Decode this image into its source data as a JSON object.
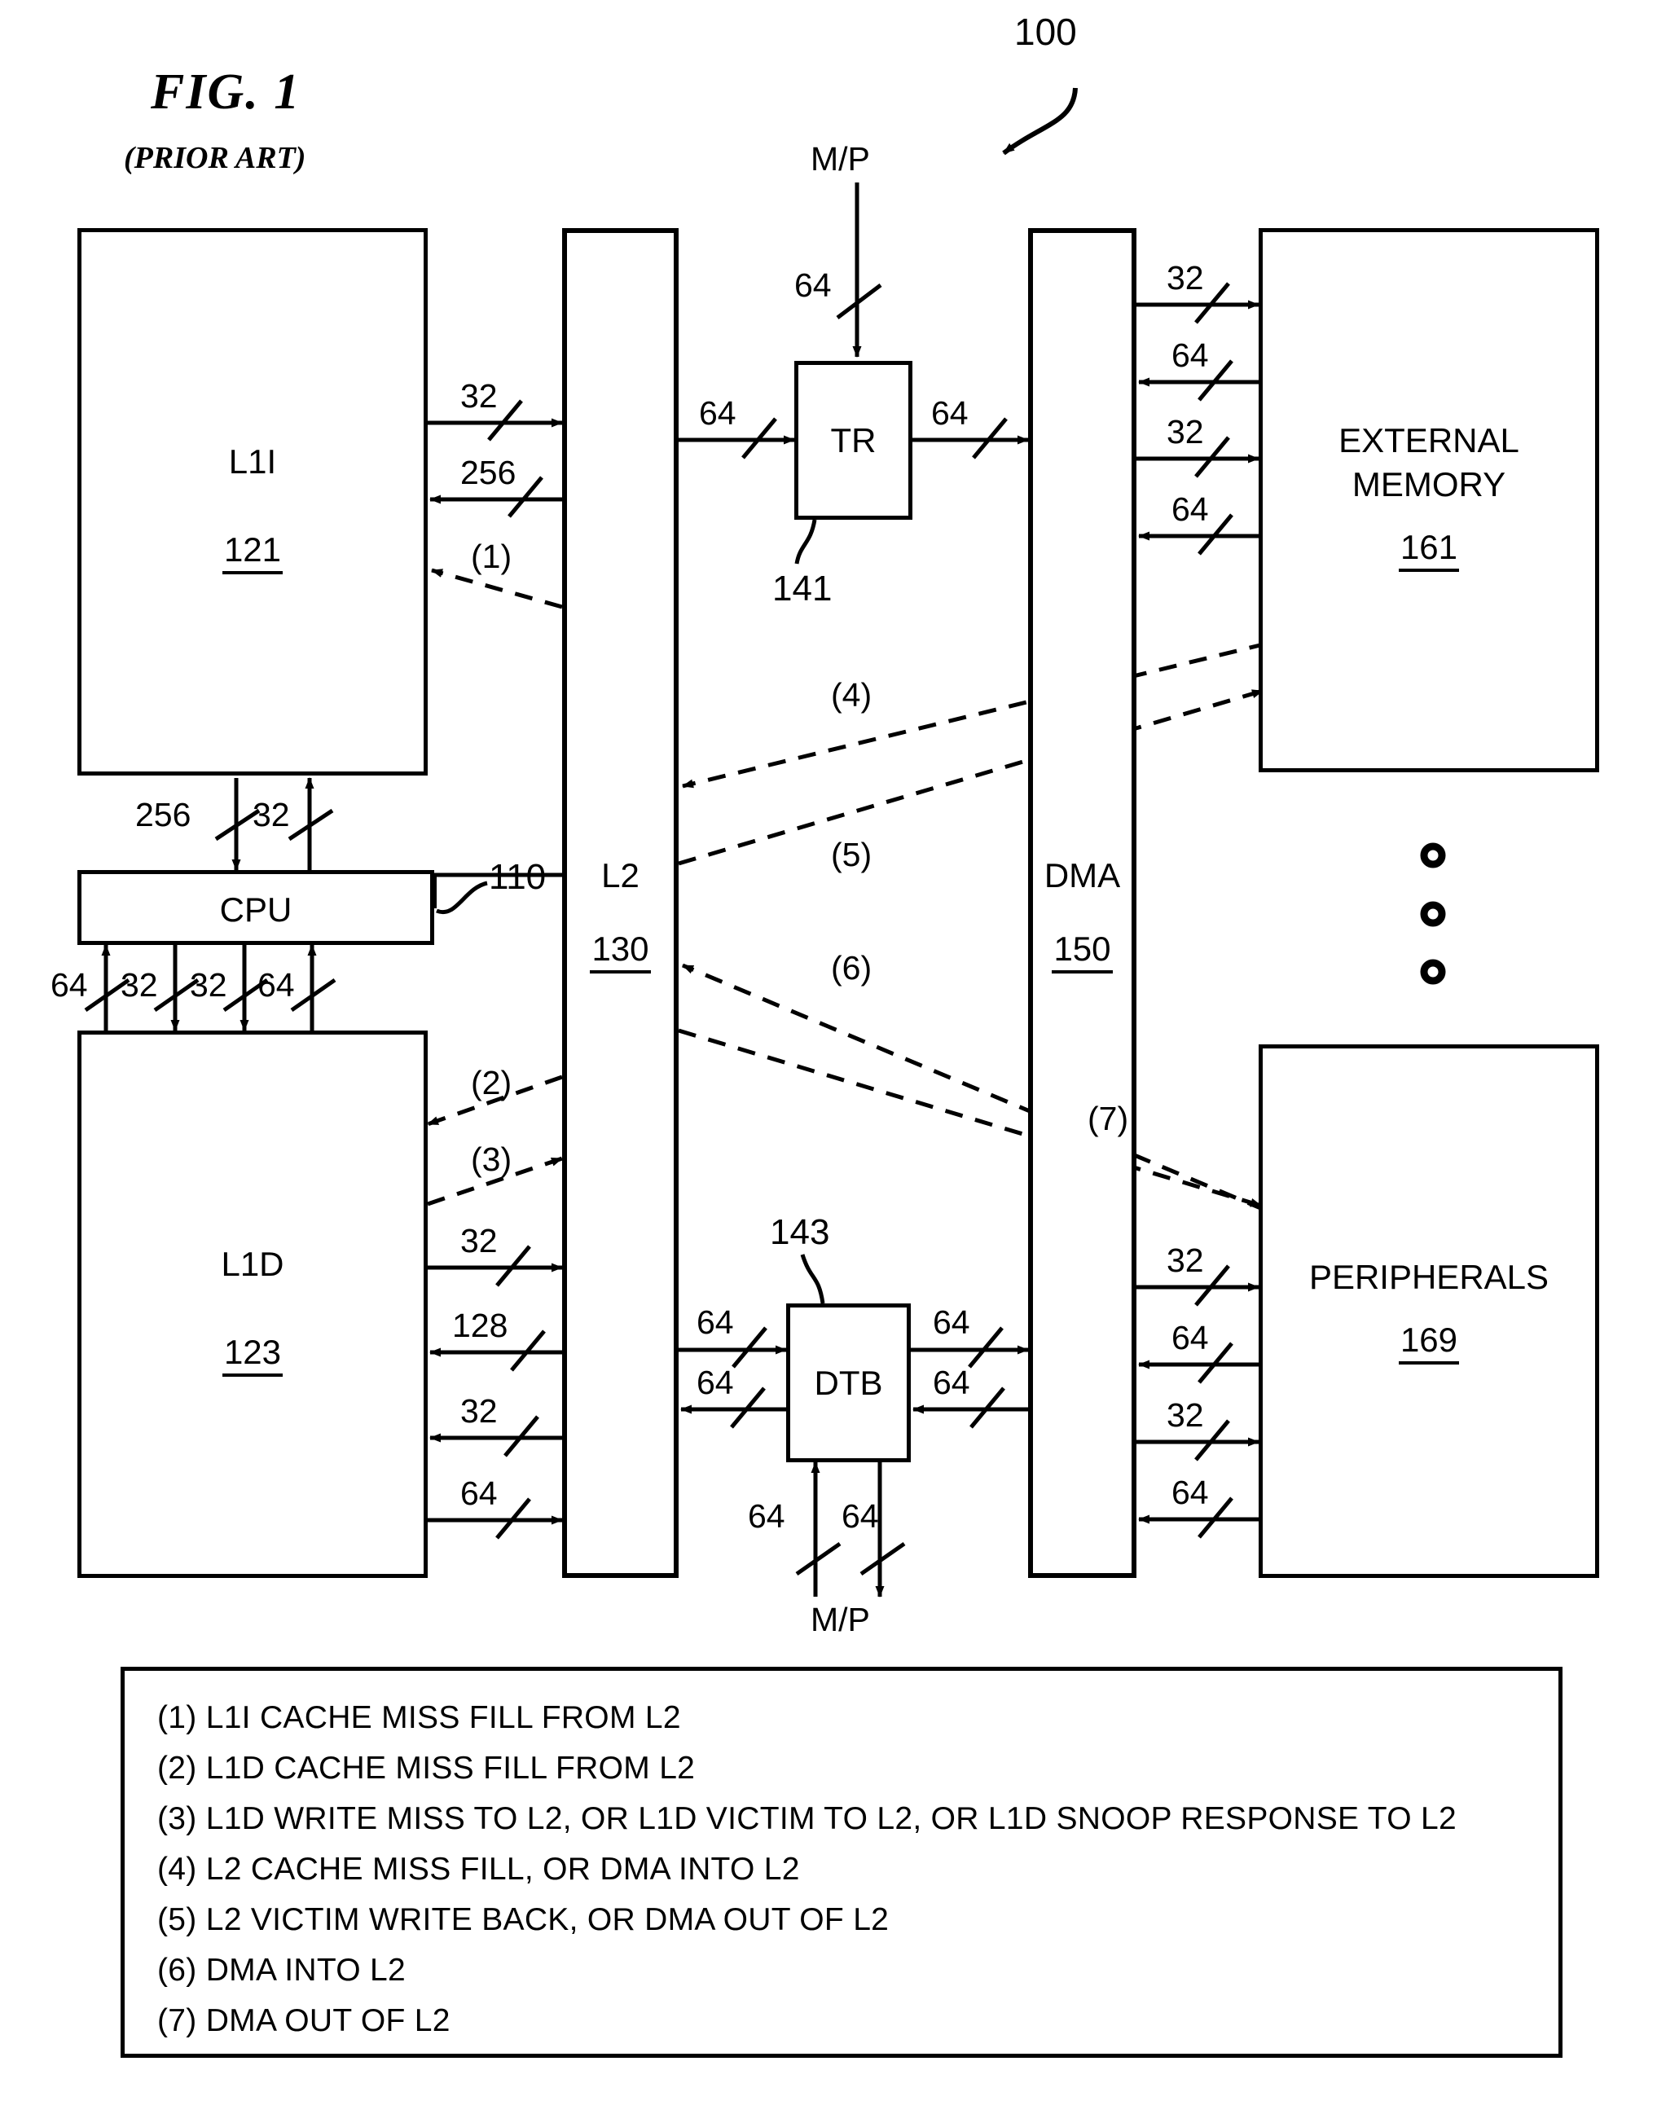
{
  "figure": {
    "title": "FIG. 1",
    "subtitle": "(PRIOR ART)",
    "system_ref": "100"
  },
  "blocks": {
    "l1i": {
      "label": "L1I",
      "ref": "121"
    },
    "cpu": {
      "label": "CPU",
      "ref": "110"
    },
    "l1d": {
      "label": "L1D",
      "ref": "123"
    },
    "l2": {
      "label": "L2",
      "ref": "130"
    },
    "dma": {
      "label": "DMA",
      "ref": "150"
    },
    "tr": {
      "label": "TR",
      "ref": "141"
    },
    "dtb": {
      "label": "DTB",
      "ref": "143"
    },
    "external_memory": {
      "label_line1": "EXTERNAL",
      "label_line2": "MEMORY",
      "ref": "161"
    },
    "peripherals": {
      "label": "PERIPHERALS",
      "ref": "169"
    }
  },
  "external_ports": {
    "mp_top": "M/P",
    "mp_bottom": "M/P"
  },
  "bus_widths": {
    "l1i_to_l2": "32",
    "l2_to_l1i": "256",
    "l2_to_cpu": "256",
    "cpu_to_l2": "32",
    "cpu_left_64": "64",
    "cpu_left_32": "32",
    "cpu_right_32": "32",
    "cpu_right_64": "64",
    "l1d_to_l2_a": "32",
    "l2_to_l1d_128": "128",
    "l2_to_l1d_32": "32",
    "l1d_to_l2_b": "64",
    "mp_to_tr": "64",
    "l2_to_tr": "64",
    "tr_to_dma": "64",
    "l2_to_dtb": "64",
    "dtb_to_l2": "64",
    "dtb_to_dma": "64",
    "dma_to_dtb": "64",
    "mp_to_dtb": "64",
    "dtb_to_mp": "64",
    "dma_to_extmem_32a": "32",
    "extmem_to_dma_64a": "64",
    "dma_to_extmem_32b": "32",
    "extmem_to_dma_64b": "64",
    "dma_to_periph_32a": "32",
    "periph_to_dma_64a": "64",
    "dma_to_periph_32b": "32",
    "periph_to_dma_64b": "64"
  },
  "flow_markers": {
    "m1": "(1)",
    "m2": "(2)",
    "m3": "(3)",
    "m4": "(4)",
    "m5": "(5)",
    "m6": "(6)",
    "m7": "(7)"
  },
  "legend": {
    "items": [
      "(1) L1I CACHE MISS FILL FROM L2",
      "(2) L1D CACHE MISS FILL FROM L2",
      "(3) L1D WRITE MISS TO L2, OR L1D VICTIM TO L2, OR L1D SNOOP RESPONSE TO L2",
      "(4) L2 CACHE MISS FILL, OR DMA INTO L2",
      "(5) L2 VICTIM WRITE BACK, OR DMA OUT OF L2",
      "(6) DMA INTO L2",
      "(7) DMA OUT OF L2"
    ]
  },
  "colors": {
    "ink": "#000000",
    "paper": "#ffffff"
  }
}
